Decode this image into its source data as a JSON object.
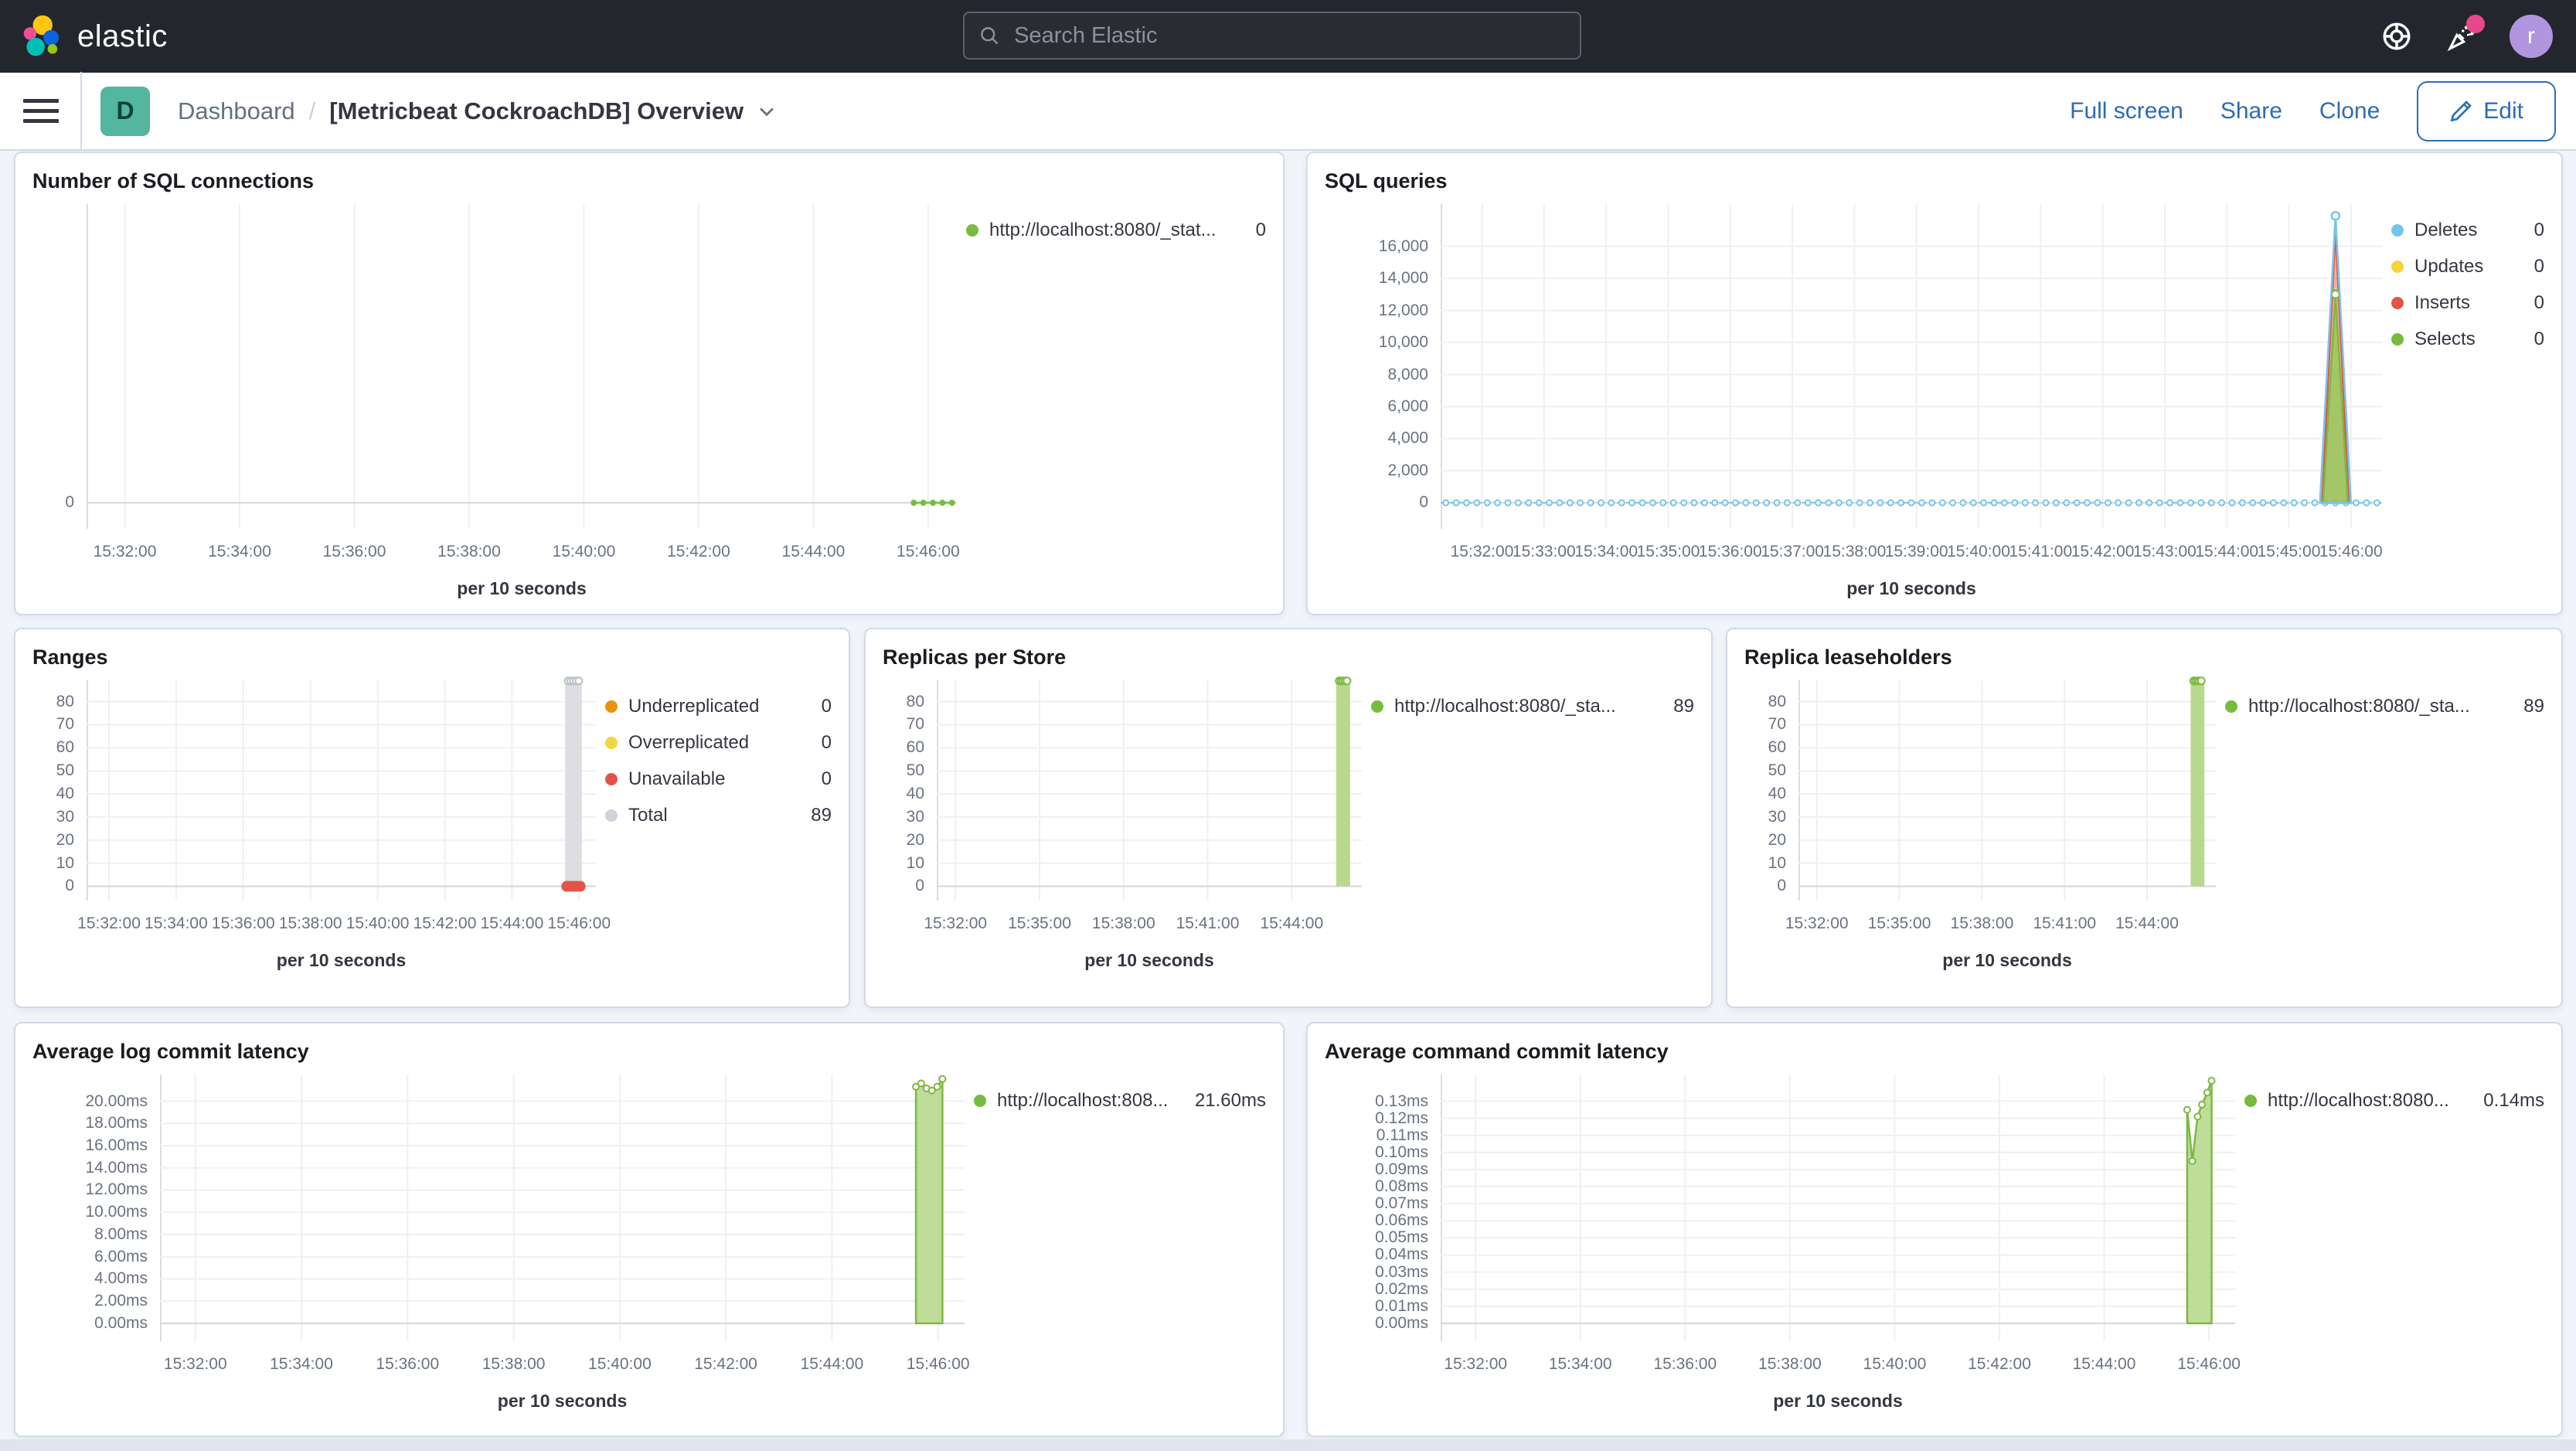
{
  "header": {
    "brand": "elastic",
    "search_placeholder": "Search Elastic",
    "user_initial": "r",
    "accent_colors": {
      "header_bg": "#24262d",
      "link_blue": "#2b6cb5",
      "notification_pink": "#e8488b",
      "avatar_purple": "#b195df",
      "dashboard_badge_teal": "#53b69f"
    }
  },
  "nav": {
    "dashboard_initial": "D",
    "breadcrumb_root": "Dashboard",
    "breadcrumb_separator": "/",
    "title": "[Metricbeat CockroachDB] Overview",
    "actions": [
      "Full screen",
      "Share",
      "Clone"
    ],
    "edit_label": "Edit"
  },
  "panels": [
    {
      "id": "sql-connections",
      "title": "Number of SQL connections",
      "xlabel": "per 10 seconds",
      "type": "line",
      "x_domain": [
        "15:31:20",
        "15:46:30"
      ],
      "x_ticks": [
        "15:32:00",
        "15:34:00",
        "15:36:00",
        "15:38:00",
        "15:40:00",
        "15:42:00",
        "15:44:00",
        "15:46:00"
      ],
      "y_ticks": [
        {
          "v": 0,
          "label": "0"
        }
      ],
      "y_top_value": 1,
      "y_top_frac": 0.1,
      "y_zero_frac": 0.92,
      "legend": [
        {
          "color": "#77bc3f",
          "label": "http://localhost:8080/_stat...",
          "value": "0"
        }
      ],
      "series": [
        {
          "kind": "markerline",
          "color": "#77bc3f",
          "r": 4,
          "points": [
            [
              "15:45:45",
              0
            ],
            [
              "15:45:55",
              0
            ],
            [
              "15:46:05",
              0
            ],
            [
              "15:46:15",
              0
            ],
            [
              "15:46:25",
              0
            ]
          ]
        }
      ]
    },
    {
      "id": "sql-queries",
      "title": "SQL queries",
      "xlabel": "per 10 seconds",
      "type": "line",
      "x_domain": [
        "15:31:20",
        "15:46:30"
      ],
      "x_ticks": [
        "15:32:00",
        "15:33:00",
        "15:34:00",
        "15:35:00",
        "15:36:00",
        "15:37:00",
        "15:38:00",
        "15:39:00",
        "15:40:00",
        "15:41:00",
        "15:42:00",
        "15:43:00",
        "15:44:00",
        "15:45:00",
        "15:46:00"
      ],
      "y_ticks": [
        {
          "v": 0,
          "label": "0"
        },
        {
          "v": 2000,
          "label": "2,000"
        },
        {
          "v": 4000,
          "label": "4,000"
        },
        {
          "v": 6000,
          "label": "6,000"
        },
        {
          "v": 8000,
          "label": "8,000"
        },
        {
          "v": 10000,
          "label": "10,000"
        },
        {
          "v": 12000,
          "label": "12,000"
        },
        {
          "v": 14000,
          "label": "14,000"
        },
        {
          "v": 16000,
          "label": "16,000"
        }
      ],
      "y_top_value": 16000,
      "y_top_frac": 0.13,
      "y_zero_frac": 0.92,
      "legend": [
        {
          "color": "#79c3ea",
          "label": "Deletes",
          "value": "0"
        },
        {
          "color": "#f2d53e",
          "label": "Updates",
          "value": "0"
        },
        {
          "color": "#e35448",
          "label": "Inserts",
          "value": "0"
        },
        {
          "color": "#77bc3f",
          "label": "Selects",
          "value": "0"
        }
      ],
      "series": [
        {
          "kind": "dotline",
          "color": "#79c3ea",
          "y": 0,
          "step": 10
        },
        {
          "kind": "spike",
          "stroke": "#e35448",
          "fill": "rgba(227,84,72,0.45)",
          "base": [
            "15:45:32",
            "15:45:58"
          ],
          "peak_t": "15:45:45",
          "peak_v": 17000
        },
        {
          "kind": "spike",
          "stroke": "#7eb840",
          "fill": "rgba(151,200,92,0.85)",
          "base": [
            "15:45:33",
            "15:45:57"
          ],
          "peak_t": "15:45:45",
          "peak_v": 13000,
          "marker": true
        },
        {
          "kind": "spike",
          "stroke": "#79c3ea",
          "fill": "none",
          "base": [
            "15:45:30",
            "15:46:00"
          ],
          "peak_t": "15:45:45",
          "peak_v": 17900,
          "marker": true
        }
      ]
    },
    {
      "id": "ranges",
      "title": "Ranges",
      "xlabel": "per 10 seconds",
      "type": "bar",
      "x_domain": [
        "15:31:20",
        "15:46:30"
      ],
      "x_ticks": [
        "15:32:00",
        "15:34:00",
        "15:36:00",
        "15:38:00",
        "15:40:00",
        "15:42:00",
        "15:44:00",
        "15:46:00"
      ],
      "y_ticks": [
        {
          "v": 0,
          "label": "0"
        },
        {
          "v": 10,
          "label": "10"
        },
        {
          "v": 20,
          "label": "20"
        },
        {
          "v": 30,
          "label": "30"
        },
        {
          "v": 40,
          "label": "40"
        },
        {
          "v": 50,
          "label": "50"
        },
        {
          "v": 60,
          "label": "60"
        },
        {
          "v": 70,
          "label": "70"
        },
        {
          "v": 80,
          "label": "80"
        }
      ],
      "y_top_value": 80,
      "y_top_frac": 0.097,
      "y_zero_frac": 0.935,
      "legend": [
        {
          "color": "#e8930c",
          "label": "Underreplicated",
          "value": "0"
        },
        {
          "color": "#f2d53e",
          "label": "Overreplicated",
          "value": "0"
        },
        {
          "color": "#e35448",
          "label": "Unavailable",
          "value": "0"
        },
        {
          "color": "#d0d4da",
          "label": "Total",
          "value": "89"
        }
      ],
      "series": [
        {
          "kind": "bar",
          "fill": "#dcdee2",
          "t1": "15:45:35",
          "t2": "15:46:05",
          "top": 89,
          "markers": 5,
          "marker_stroke": "#b9bec7"
        },
        {
          "kind": "dots",
          "color": "#e35448",
          "y": 0,
          "r": 7,
          "points": [
            "15:45:38",
            "15:45:44",
            "15:45:50",
            "15:45:56",
            "15:46:02"
          ]
        }
      ]
    },
    {
      "id": "replicas-per-store",
      "title": "Replicas per Store",
      "xlabel": "per 10 seconds",
      "type": "bar",
      "x_domain": [
        "15:31:20",
        "15:46:30"
      ],
      "x_ticks": [
        "15:32:00",
        "15:35:00",
        "15:38:00",
        "15:41:00",
        "15:44:00"
      ],
      "y_ticks": [
        {
          "v": 0,
          "label": "0"
        },
        {
          "v": 10,
          "label": "10"
        },
        {
          "v": 20,
          "label": "20"
        },
        {
          "v": 30,
          "label": "30"
        },
        {
          "v": 40,
          "label": "40"
        },
        {
          "v": 50,
          "label": "50"
        },
        {
          "v": 60,
          "label": "60"
        },
        {
          "v": 70,
          "label": "70"
        },
        {
          "v": 80,
          "label": "80"
        }
      ],
      "y_top_value": 80,
      "y_top_frac": 0.097,
      "y_zero_frac": 0.935,
      "legend": [
        {
          "color": "#77bc3f",
          "label": "http://localhost:8080/_sta...",
          "value": "89"
        }
      ],
      "series": [
        {
          "kind": "bar",
          "fill": "#b8d98d",
          "t1": "15:45:35",
          "t2": "15:46:05",
          "top": 89,
          "markers": 5,
          "marker_stroke": "#7eb840"
        }
      ]
    },
    {
      "id": "replica-leaseholders",
      "title": "Replica leaseholders",
      "xlabel": "per 10 seconds",
      "type": "bar",
      "x_domain": [
        "15:31:20",
        "15:46:30"
      ],
      "x_ticks": [
        "15:32:00",
        "15:35:00",
        "15:38:00",
        "15:41:00",
        "15:44:00"
      ],
      "y_ticks": [
        {
          "v": 0,
          "label": "0"
        },
        {
          "v": 10,
          "label": "10"
        },
        {
          "v": 20,
          "label": "20"
        },
        {
          "v": 30,
          "label": "30"
        },
        {
          "v": 40,
          "label": "40"
        },
        {
          "v": 50,
          "label": "50"
        },
        {
          "v": 60,
          "label": "60"
        },
        {
          "v": 70,
          "label": "70"
        },
        {
          "v": 80,
          "label": "80"
        }
      ],
      "y_top_value": 80,
      "y_top_frac": 0.097,
      "y_zero_frac": 0.935,
      "legend": [
        {
          "color": "#77bc3f",
          "label": "http://localhost:8080/_sta...",
          "value": "89"
        }
      ],
      "series": [
        {
          "kind": "bar",
          "fill": "#b8d98d",
          "t1": "15:45:35",
          "t2": "15:46:05",
          "top": 89,
          "markers": 5,
          "marker_stroke": "#7eb840"
        }
      ]
    },
    {
      "id": "avg-log-commit-latency",
      "title": "Average log commit latency",
      "xlabel": "per 10 seconds",
      "type": "area",
      "x_domain": [
        "15:31:20",
        "15:46:30"
      ],
      "x_ticks": [
        "15:32:00",
        "15:34:00",
        "15:36:00",
        "15:38:00",
        "15:40:00",
        "15:42:00",
        "15:44:00",
        "15:46:00"
      ],
      "y_ticks": [
        {
          "v": 0,
          "label": "0.00ms"
        },
        {
          "v": 2,
          "label": "2.00ms"
        },
        {
          "v": 4,
          "label": "4.00ms"
        },
        {
          "v": 6,
          "label": "6.00ms"
        },
        {
          "v": 8,
          "label": "8.00ms"
        },
        {
          "v": 10,
          "label": "10.00ms"
        },
        {
          "v": 12,
          "label": "12.00ms"
        },
        {
          "v": 14,
          "label": "14.00ms"
        },
        {
          "v": 16,
          "label": "16.00ms"
        },
        {
          "v": 18,
          "label": "18.00ms"
        },
        {
          "v": 20,
          "label": "20.00ms"
        }
      ],
      "y_top_value": 20,
      "y_top_frac": 0.1,
      "y_zero_frac": 0.933,
      "legend": [
        {
          "color": "#77bc3f",
          "label": "http://localhost:808...",
          "value": "21.60ms"
        }
      ],
      "series": [
        {
          "kind": "area",
          "stroke": "#7eb840",
          "fill": "rgba(184,217,141,0.9)",
          "marker": true,
          "points": [
            [
              "15:45:35",
              21.3
            ],
            [
              "15:45:41",
              21.6
            ],
            [
              "15:45:47",
              21.15
            ],
            [
              "15:45:53",
              20.95
            ],
            [
              "15:45:59",
              21.3
            ],
            [
              "15:46:05",
              22.0
            ]
          ]
        }
      ]
    },
    {
      "id": "avg-command-commit-latency",
      "title": "Average command commit latency",
      "xlabel": "per 10 seconds",
      "type": "area",
      "x_domain": [
        "15:31:20",
        "15:46:30"
      ],
      "x_ticks": [
        "15:32:00",
        "15:34:00",
        "15:36:00",
        "15:38:00",
        "15:40:00",
        "15:42:00",
        "15:44:00",
        "15:46:00"
      ],
      "y_ticks": [
        {
          "v": 0,
          "label": "0.00ms"
        },
        {
          "v": 0.01,
          "label": "0.01ms"
        },
        {
          "v": 0.02,
          "label": "0.02ms"
        },
        {
          "v": 0.03,
          "label": "0.03ms"
        },
        {
          "v": 0.04,
          "label": "0.04ms"
        },
        {
          "v": 0.05,
          "label": "0.05ms"
        },
        {
          "v": 0.06,
          "label": "0.06ms"
        },
        {
          "v": 0.07,
          "label": "0.07ms"
        },
        {
          "v": 0.08,
          "label": "0.08ms"
        },
        {
          "v": 0.09,
          "label": "0.09ms"
        },
        {
          "v": 0.1,
          "label": "0.10ms"
        },
        {
          "v": 0.11,
          "label": "0.11ms"
        },
        {
          "v": 0.12,
          "label": "0.12ms"
        },
        {
          "v": 0.13,
          "label": "0.13ms"
        }
      ],
      "y_top_value": 0.13,
      "y_top_frac": 0.1,
      "y_zero_frac": 0.933,
      "legend": [
        {
          "color": "#77bc3f",
          "label": "http://localhost:8080...",
          "value": "0.14ms"
        }
      ],
      "series": [
        {
          "kind": "area",
          "stroke": "#7eb840",
          "fill": "rgba(184,217,141,0.9)",
          "marker": true,
          "points": [
            [
              "15:45:35",
              0.125
            ],
            [
              "15:45:41",
              0.095
            ],
            [
              "15:45:47",
              0.121
            ],
            [
              "15:45:52",
              0.128
            ],
            [
              "15:45:58",
              0.135
            ],
            [
              "15:46:03",
              0.142
            ]
          ]
        }
      ]
    }
  ]
}
